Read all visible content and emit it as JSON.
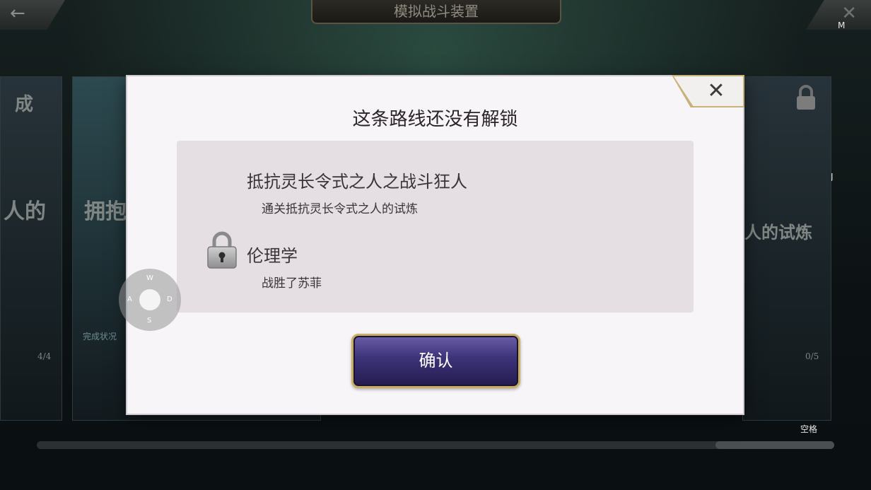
{
  "header": {
    "title": "模拟战斗装置"
  },
  "background": {
    "left_card_text_top": "成",
    "left_card_text_mid": "人的",
    "left_card_progress": "4/4",
    "mid_card_text": "拥抱",
    "mid_card_status": "完成状况",
    "right_card_text": "人的试炼",
    "right_card_progress": "0/5"
  },
  "key_hints": {
    "m": "M",
    "j": "J",
    "space": "空格",
    "tilde": "~"
  },
  "wasd": {
    "w": "W",
    "a": "A",
    "s": "S",
    "d": "D"
  },
  "modal": {
    "title": "这条路线还没有解锁",
    "requirements": [
      {
        "title": "抵抗灵长令式之人之战斗狂人",
        "desc": "通关抵抗灵长令式之人的试炼",
        "locked": false
      },
      {
        "title": "伦理学",
        "desc": "战胜了苏菲",
        "locked": true
      }
    ],
    "confirm_label": "确认",
    "close_symbol": "✕"
  },
  "colors": {
    "confirm_bg": "#3c3278",
    "confirm_border": "#c8ad62",
    "close_tab_border": "#c8b27a"
  }
}
